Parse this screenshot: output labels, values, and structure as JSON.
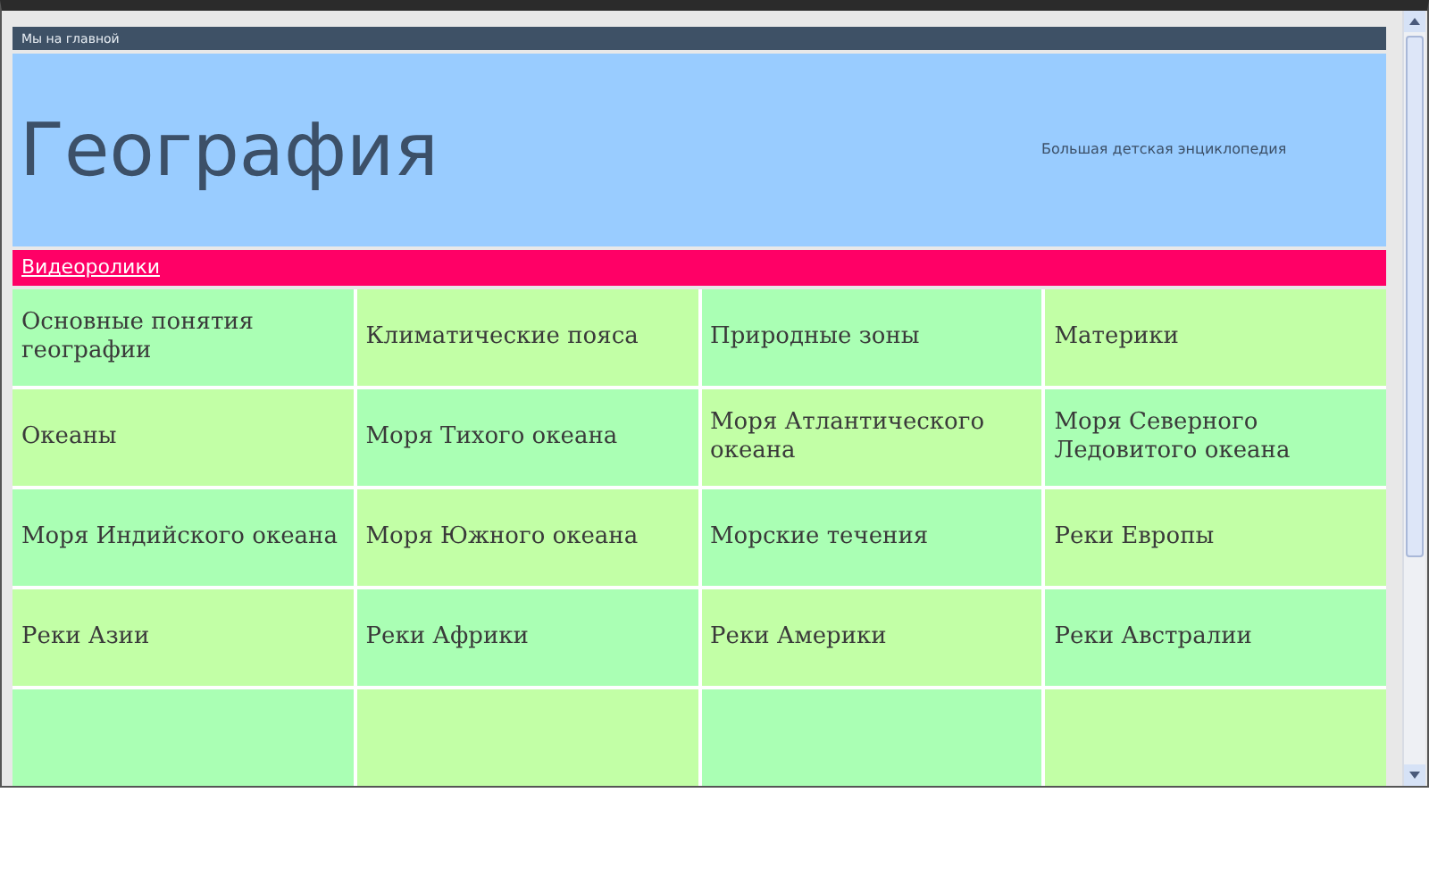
{
  "top_bar": {
    "link": "Мы на главной"
  },
  "header": {
    "title": "География",
    "subtitle": "Большая детская энциклопедия"
  },
  "section_bar": {
    "link": "Видеоролики"
  },
  "grid": {
    "rows": [
      [
        "Основные понятия географии",
        "Климатические пояса",
        "Природные зоны",
        "Материки"
      ],
      [
        "Океаны",
        "Моря Тихого океана",
        "Моря Атлантического океана",
        "Моря Северного Ледовитого океана"
      ],
      [
        "Моря Индийского океана",
        "Моря Южного океана",
        "Морские течения",
        "Реки Европы"
      ],
      [
        "Реки Азии",
        "Реки Африки",
        "Реки Америки",
        "Реки Австралии"
      ]
    ]
  }
}
